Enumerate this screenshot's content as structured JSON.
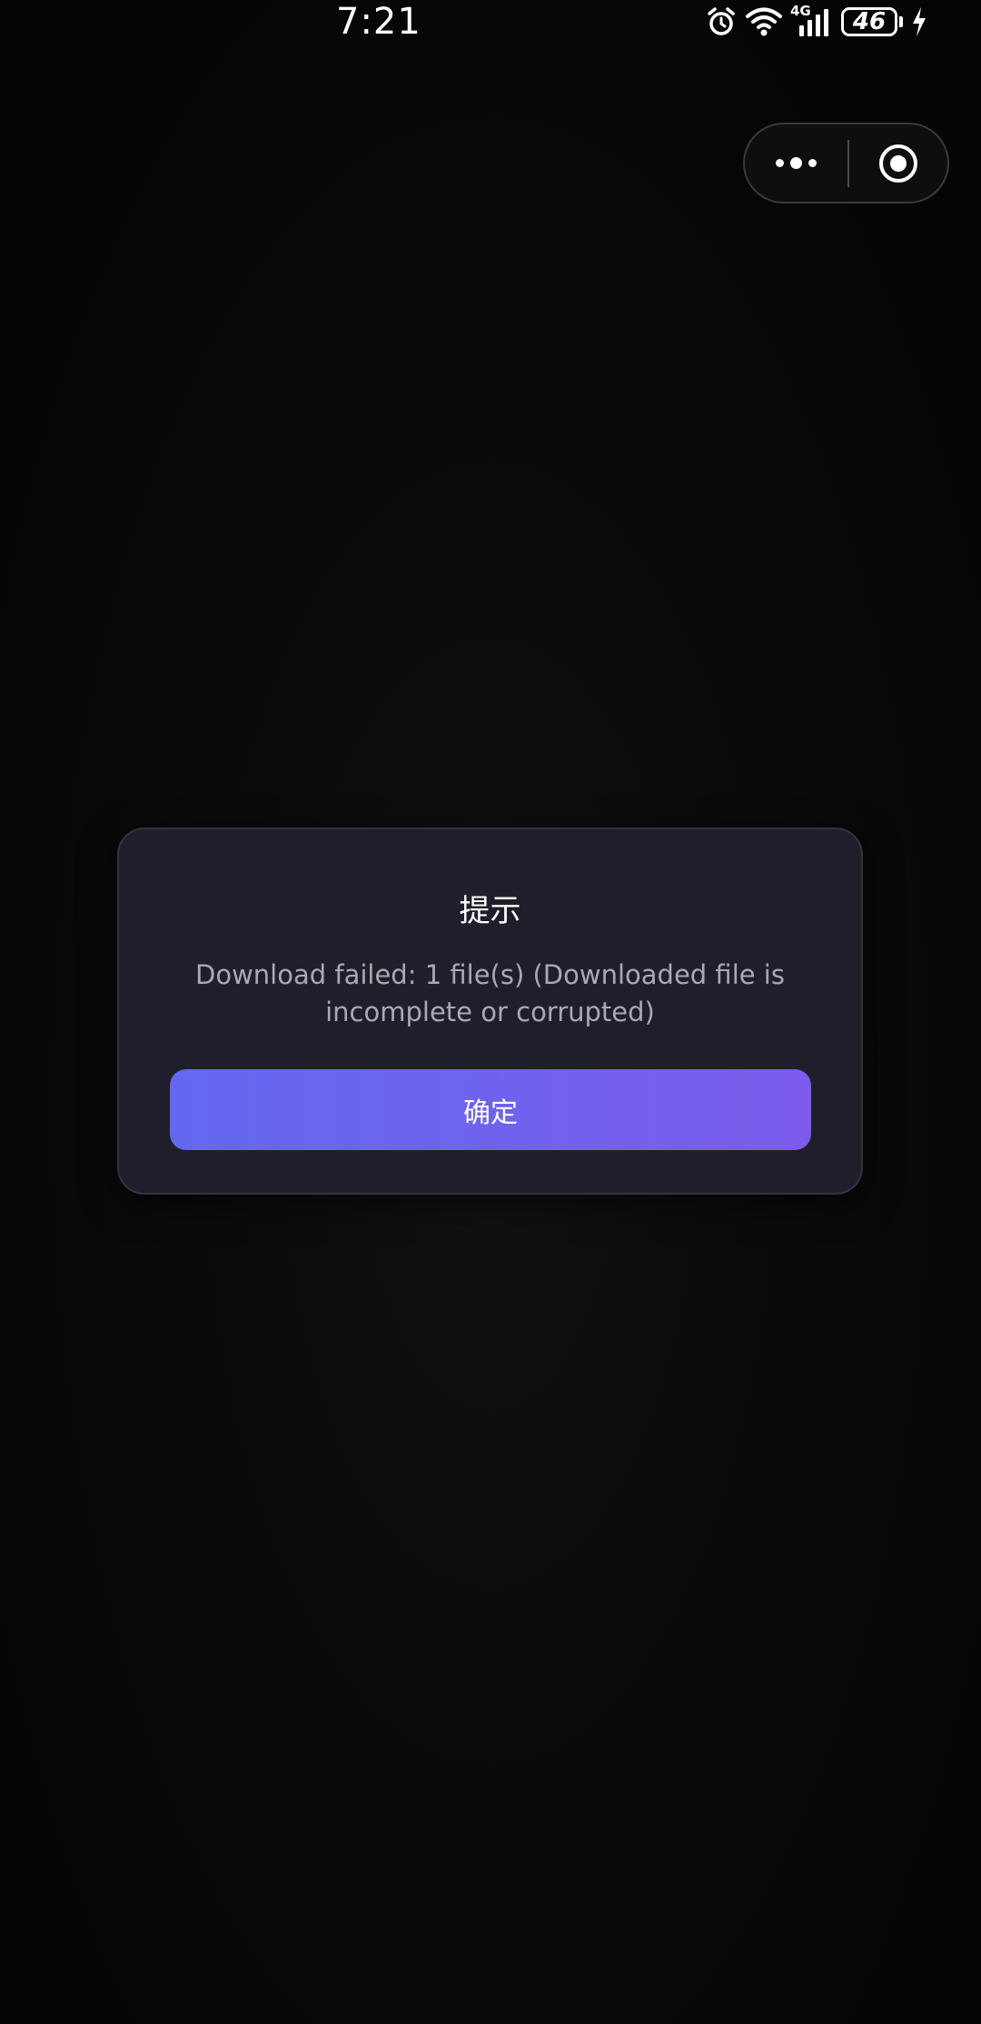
{
  "status_bar": {
    "time": "7:21",
    "network": "4G",
    "battery_level": "46",
    "icons": [
      "alarm-icon",
      "wifi-icon",
      "signal-icon",
      "battery-icon",
      "charging-icon"
    ]
  },
  "capsule": {
    "more_icon": "more-dots-icon",
    "close_icon": "target-close-icon"
  },
  "dialog": {
    "title": "提示",
    "message": "Download failed: 1 file(s) (Downloaded file is incomplete or corrupted)",
    "confirm_label": "确定"
  },
  "colors": {
    "background": "#050505",
    "dialog_background": "#1f1f2b",
    "button_gradient_start": "#6468f0",
    "button_gradient_end": "#7c5cec",
    "message_text": "#a9a9b4"
  }
}
